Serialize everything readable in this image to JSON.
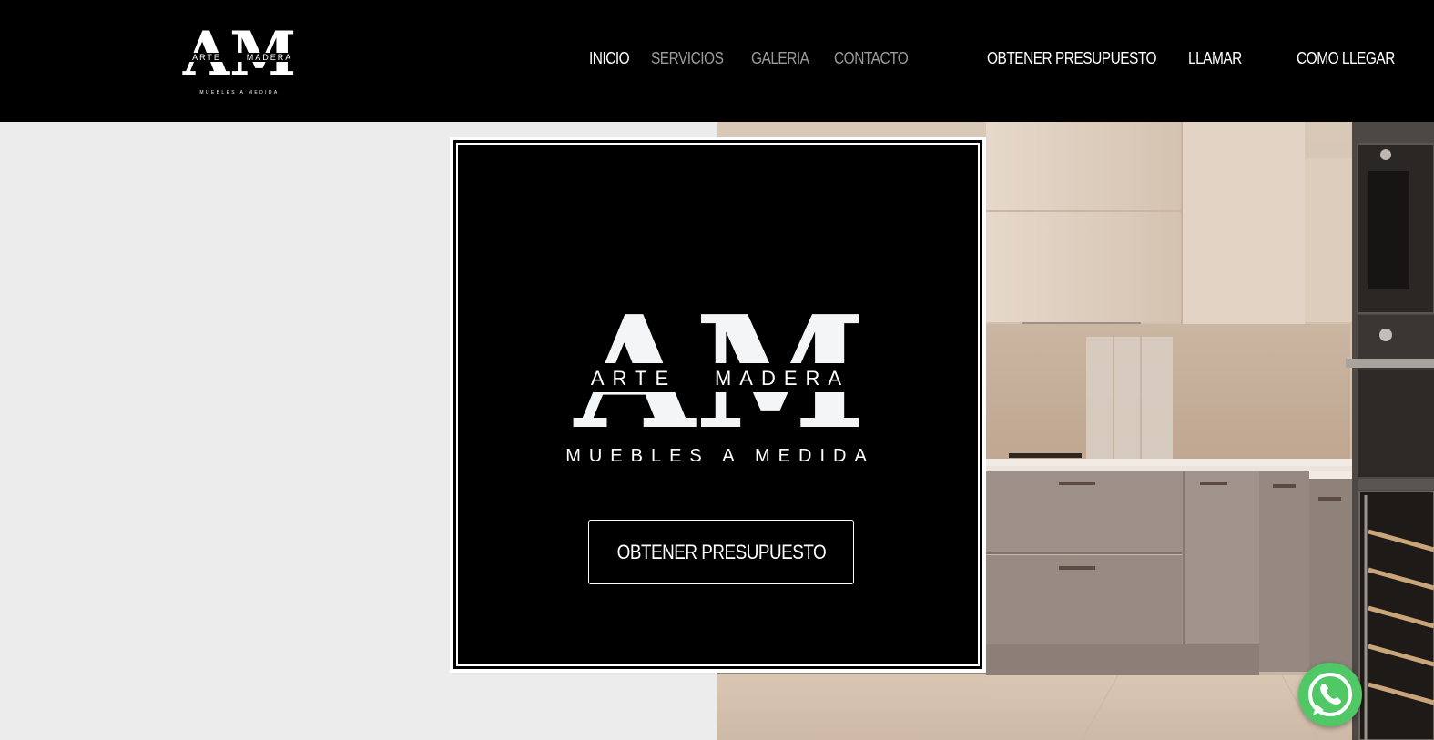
{
  "brand": {
    "monogram": "AM",
    "name": "ARTE MADERA",
    "name_left": "ARTE",
    "name_right": "MADERA",
    "tagline": "MUEBLES A MEDIDA"
  },
  "nav": {
    "items": [
      {
        "label": "INICIO",
        "active": true
      },
      {
        "label": "SERVICIOS",
        "active": false
      },
      {
        "label": "GALERIA",
        "active": false
      },
      {
        "label": "CONTACTO",
        "active": false
      }
    ]
  },
  "header_actions": {
    "quote": "OBTENER PRESUPUESTO",
    "call": "LLAMAR",
    "directions": "COMO LLEGAR"
  },
  "hero": {
    "button_label": "OBTENER PRESUPUESTO"
  },
  "floating": {
    "icon": "whatsapp-icon",
    "color": "#4fc865"
  },
  "colors": {
    "header_bg": "#000000",
    "nav_active": "#ffffff",
    "nav_inactive": "#9a9a9a",
    "panel_bg": "#ececec"
  }
}
